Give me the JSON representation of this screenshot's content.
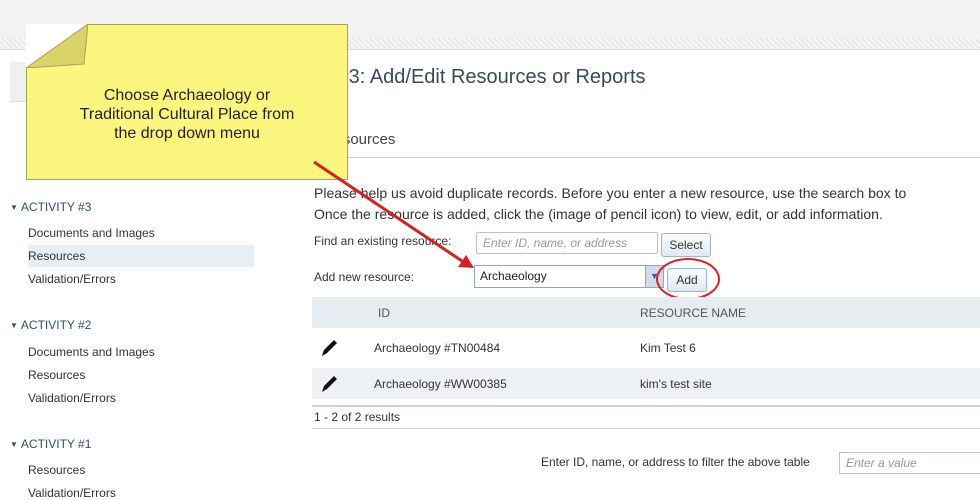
{
  "page": {
    "title": "Activity #3: Add/Edit Resources or Reports",
    "visible_title": "ity #3: Add/Edit Resources or Reports",
    "section": "y Resources"
  },
  "callout": {
    "line1": "Choose Archaeology or",
    "line2": "Traditional Cultural Place from",
    "line3": "the drop down menu"
  },
  "notice": {
    "line1": "Please help us avoid duplicate records. Before you enter a new resource, use the search box to",
    "line2": "Once the resource is added, click the (image of pencil icon) to view, edit, or add information."
  },
  "find": {
    "label": "Find an existing resource:",
    "placeholder": "Enter ID, name, or address",
    "button": "Select"
  },
  "add": {
    "label": "Add new resource:",
    "selected": "Archaeology",
    "button": "Add"
  },
  "table": {
    "columns": [
      "ID",
      "RESOURCE NAME"
    ],
    "rows": [
      {
        "id": "Archaeology #TN00484",
        "name": "Kim Test 6",
        "icon": "pencil-icon"
      },
      {
        "id": "Archaeology #WW00385",
        "name": "kim's test site",
        "icon": "pencil-icon"
      }
    ],
    "results": "1 - 2 of 2 results"
  },
  "filter": {
    "label": "Enter ID, name, or address to filter the above table",
    "placeholder": "Enter a value"
  },
  "sidebar": {
    "groups": [
      {
        "header": "ACTIVITY #3",
        "items": [
          "Documents and Images",
          "Resources",
          "Validation/Errors"
        ]
      },
      {
        "header": "ACTIVITY #2",
        "items": [
          "Documents and Images",
          "Resources",
          "Validation/Errors"
        ]
      },
      {
        "header": "ACTIVITY #1",
        "items": [
          "Resources",
          "Validation/Errors"
        ]
      }
    ],
    "active_item": "Resources"
  },
  "colors": {
    "callout": "#fbf67e",
    "arrow": "#d42020",
    "highlight_circle": "#e02020"
  }
}
